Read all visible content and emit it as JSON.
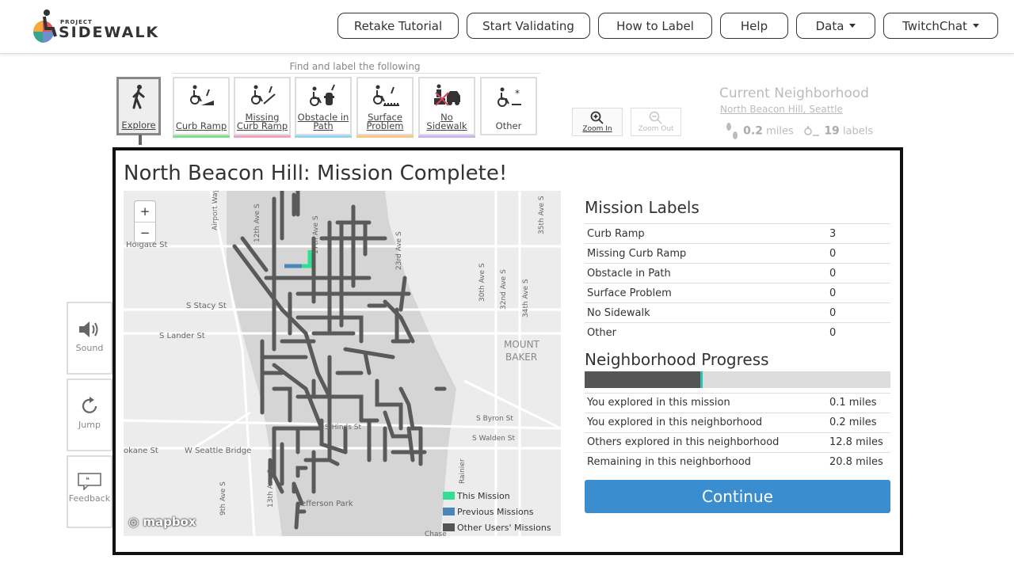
{
  "header": {
    "logo_small": "PROJECT",
    "logo_big": "SIDEWALK",
    "nav": [
      {
        "label": "Retake Tutorial"
      },
      {
        "label": "Start Validating"
      },
      {
        "label": "How to Label"
      },
      {
        "label": "Help"
      },
      {
        "label": "Data",
        "dropdown": true
      },
      {
        "label": "TwitchChat",
        "dropdown": true
      }
    ]
  },
  "toolbar": {
    "find_label": "Find and label the following",
    "tools": [
      {
        "label": "Explore",
        "icon": "pedestrian-icon",
        "color": ""
      },
      {
        "label": "Curb Ramp",
        "icon": "curb-ramp-icon",
        "color": "#7ee08c"
      },
      {
        "label": "Missing Curb Ramp",
        "icon": "missing-curb-ramp-icon",
        "color": "#f4a0c0"
      },
      {
        "label": "Obstacle in Path",
        "icon": "obstacle-icon",
        "color": "#8fd6f0"
      },
      {
        "label": "Surface Problem",
        "icon": "surface-problem-icon",
        "color": "#f9c77e"
      },
      {
        "label": "No Sidewalk",
        "icon": "no-sidewalk-icon",
        "color": "#c9b6ef"
      },
      {
        "label": "Other",
        "icon": "other-icon",
        "color": ""
      }
    ],
    "zoom_in": "Zoom In",
    "zoom_out": "Zoom Out"
  },
  "neighborhood": {
    "title": "Current Neighborhood",
    "name": "North Beacon Hill, Seattle",
    "miles": "0.2",
    "miles_unit": "miles",
    "labels": "19",
    "labels_unit": "labels"
  },
  "side_buttons": [
    {
      "label": "Sound",
      "icon": "speaker-icon"
    },
    {
      "label": "Jump",
      "icon": "jump-icon"
    },
    {
      "label": "Feedback",
      "icon": "feedback-icon"
    }
  ],
  "modal": {
    "title": "North Beacon Hill: Mission Complete!",
    "map": {
      "zoom_plus": "+",
      "zoom_minus": "−",
      "attribution": "mapbox",
      "legend": [
        {
          "label": "This Mission",
          "color": "#2ee08f"
        },
        {
          "label": "Previous Missions",
          "color": "#4a86b8"
        },
        {
          "label": "Other Users' Missions",
          "color": "#555555"
        }
      ],
      "street_labels": [
        "Holgate St",
        "S Stacy St",
        "S Lander St",
        "W Seattle Bridge",
        "okane St",
        "Jefferson Park",
        "MOUNT",
        "BAKER",
        "S Byron St",
        "S Walden St",
        "12th Ave S",
        "17th Ave S",
        "23rd Ave S",
        "30th Ave S",
        "32nd Ave S",
        "34th Ave S",
        "35th Ave S",
        "Airport Way S",
        "13th Ave S",
        "9th Ave S",
        "Hinds St",
        "Rainier",
        "Chase"
      ]
    },
    "mission_labels_title": "Mission Labels",
    "mission_labels": [
      {
        "name": "Curb Ramp",
        "count": "3"
      },
      {
        "name": "Missing Curb Ramp",
        "count": "0"
      },
      {
        "name": "Obstacle in Path",
        "count": "0"
      },
      {
        "name": "Surface Problem",
        "count": "0"
      },
      {
        "name": "No Sidewalk",
        "count": "0"
      },
      {
        "name": "Other",
        "count": "0"
      }
    ],
    "progress_title": "Neighborhood Progress",
    "progress_fraction": 0.38,
    "progress_stats": [
      {
        "name": "You explored in this mission",
        "value": "0.1 miles"
      },
      {
        "name": "You explored in this neighborhood",
        "value": "0.2 miles"
      },
      {
        "name": "Others explored in this neighborhood",
        "value": "12.8 miles"
      },
      {
        "name": "Remaining in this neighborhood",
        "value": "20.8 miles"
      }
    ],
    "continue_label": "Continue"
  }
}
